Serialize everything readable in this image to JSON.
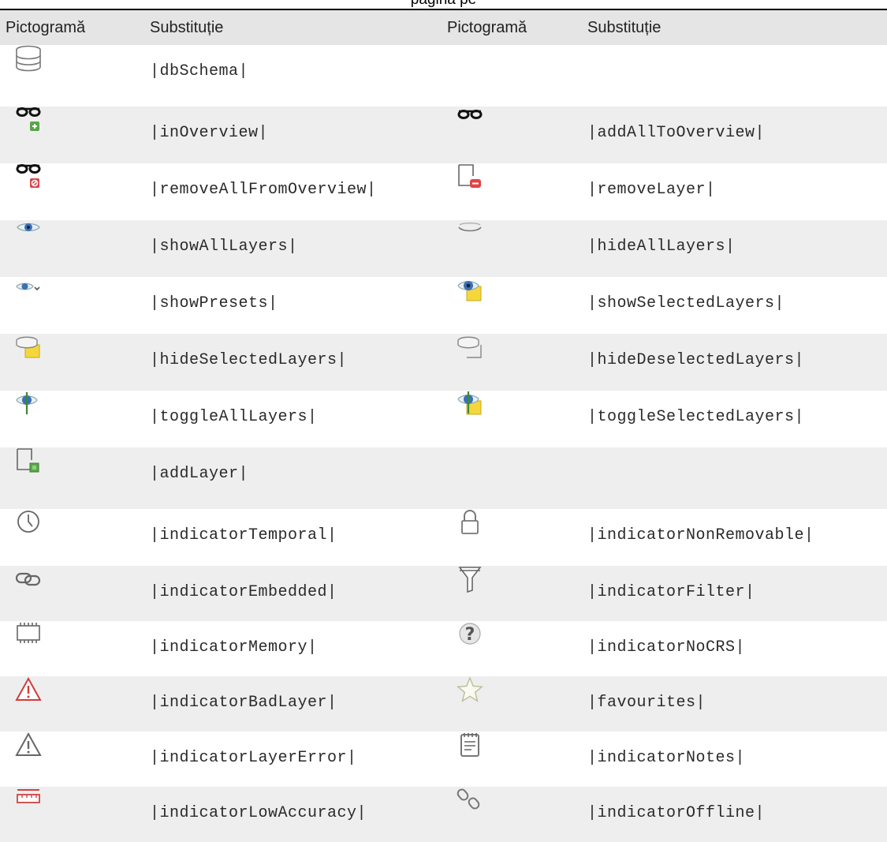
{
  "header": {
    "cutoff_text": "pagină pe",
    "col1": "Pictogramă",
    "col2": "Substituție",
    "col3": "Pictogramă",
    "col4": "Substituție"
  },
  "rows": [
    {
      "left": {
        "icon": "database-icon",
        "sub": "|dbSchema|"
      },
      "right": null
    },
    {
      "left": {
        "icon": "glasses-add-icon",
        "sub": "|inOverview|"
      },
      "right": {
        "icon": "glasses-icon",
        "sub": "|addAllToOverview|"
      }
    },
    {
      "left": {
        "icon": "glasses-remove-icon",
        "sub": "|removeAllFromOverview|"
      },
      "right": {
        "icon": "layer-remove-icon",
        "sub": "|removeLayer|"
      }
    },
    {
      "left": {
        "icon": "eye-icon",
        "sub": "|showAllLayers|"
      },
      "right": {
        "icon": "eye-closed-icon",
        "sub": "|hideAllLayers|"
      }
    },
    {
      "left": {
        "icon": "eye-presets-icon",
        "sub": "|showPresets|"
      },
      "right": {
        "icon": "eye-selected-icon",
        "sub": "|showSelectedLayers|"
      }
    },
    {
      "left": {
        "icon": "eye-closed-selected-icon",
        "sub": "|hideSelectedLayers|"
      },
      "right": {
        "icon": "eye-closed-deselected-icon",
        "sub": "|hideDeselectedLayers|"
      }
    },
    {
      "left": {
        "icon": "eye-toggle-icon",
        "sub": "|toggleAllLayers|"
      },
      "right": {
        "icon": "eye-toggle-selected-icon",
        "sub": "|toggleSelectedLayers|"
      }
    },
    {
      "left": {
        "icon": "layer-add-icon",
        "sub": "|addLayer|"
      },
      "right": null
    },
    {
      "left": {
        "icon": "clock-icon",
        "sub": "|indicatorTemporal|"
      },
      "right": {
        "icon": "lock-icon",
        "sub": "|indicatorNonRemovable|"
      }
    },
    {
      "left": {
        "icon": "link-icon",
        "sub": "|indicatorEmbedded|"
      },
      "right": {
        "icon": "filter-icon",
        "sub": "|indicatorFilter|"
      }
    },
    {
      "left": {
        "icon": "memory-icon",
        "sub": "|indicatorMemory|"
      },
      "right": {
        "icon": "globe-question-icon",
        "sub": "|indicatorNoCRS|"
      }
    },
    {
      "left": {
        "icon": "warning-red-icon",
        "sub": "|indicatorBadLayer|"
      },
      "right": {
        "icon": "star-icon",
        "sub": "|favourites|"
      }
    },
    {
      "left": {
        "icon": "warning-icon",
        "sub": "|indicatorLayerError|"
      },
      "right": {
        "icon": "notes-icon",
        "sub": "|indicatorNotes|"
      }
    },
    {
      "left": {
        "icon": "ruler-icon",
        "sub": "|indicatorLowAccuracy|"
      },
      "right": {
        "icon": "offline-link-icon",
        "sub": "|indicatorOffline|"
      }
    }
  ]
}
